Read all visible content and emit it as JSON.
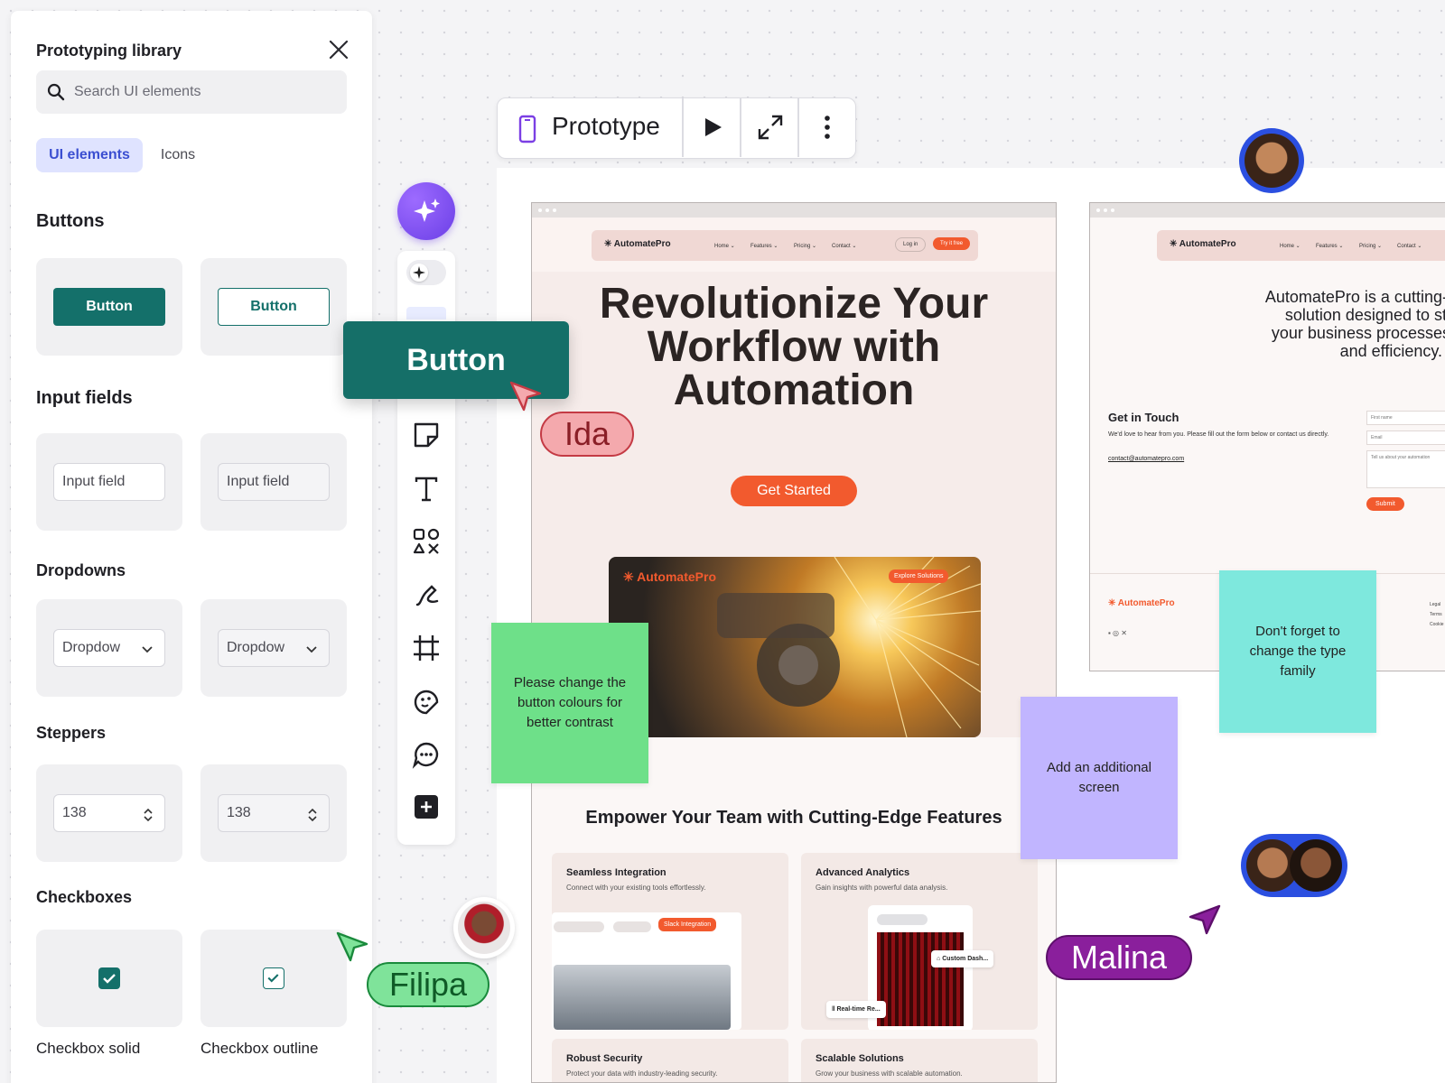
{
  "library": {
    "title": "Prototyping library",
    "search_placeholder": "Search UI elements",
    "tabs": [
      "UI elements",
      "Icons"
    ],
    "sections": {
      "buttons": "Buttons",
      "inputs": "Input fields",
      "dropdowns": "Dropdowns",
      "steppers": "Steppers",
      "checkboxes": "Checkboxes"
    },
    "button_label": "Button",
    "input_label": "Input field",
    "dropdown_label": "Dropdow",
    "stepper_value": "138",
    "checkbox_captions": [
      "Checkbox solid",
      "Checkbox outline"
    ],
    "accent_color": "#14706a"
  },
  "drag_button_label": "Button",
  "prototype_bar": {
    "label": "Prototype"
  },
  "site1": {
    "brand": "AutomatePro",
    "nav": [
      "Home",
      "Features",
      "Pricing",
      "Contact"
    ],
    "login": "Log in",
    "try": "Try it free",
    "hero": [
      "Revolutionize Your",
      "Workflow with",
      "Automation"
    ],
    "cta": "Get Started",
    "photo_badge": "Explore Solutions",
    "features_title": "Empower Your Team with Cutting-Edge Features",
    "cards": [
      {
        "title": "Seamless Integration",
        "sub": "Connect with your existing tools effortlessly.",
        "chip": "Slack Integration"
      },
      {
        "title": "Advanced Analytics",
        "sub": "Gain insights with powerful data analysis.",
        "chip": "Custom Dash...",
        "chip2": "Real-time Re..."
      },
      {
        "title": "Robust Security",
        "sub": "Protect your data with industry-leading security."
      },
      {
        "title": "Scalable Solutions",
        "sub": "Grow your business with scalable automation."
      }
    ]
  },
  "site2": {
    "brand": "AutomatePro",
    "nav": [
      "Home",
      "Features",
      "Pricing",
      "Contact"
    ],
    "about": [
      "AutomatePro is a cutting-edge",
      "solution designed to stream",
      "your business processes with",
      "and efficiency."
    ],
    "contact_title": "Get in Touch",
    "contact_text": "We'd love to hear from you. Please fill out the form below or contact us directly.",
    "email": "contact@automatepro.com",
    "fields": [
      "First name",
      "Email",
      "Tell us about your automation"
    ],
    "submit": "Submit",
    "footer_links": [
      "Legal",
      "Terms",
      "Cookie"
    ]
  },
  "stickies": {
    "green": "Please change the button colours for better contrast",
    "teal": "Don't forget to change the type family",
    "purple": "Add an additional screen"
  },
  "cursors": {
    "ida": {
      "name": "Ida",
      "color": "#f4a9ad"
    },
    "filipa": {
      "name": "Filipa",
      "color": "#7fe39a"
    },
    "malina": {
      "name": "Malina",
      "color": "#8a1f9c"
    }
  }
}
